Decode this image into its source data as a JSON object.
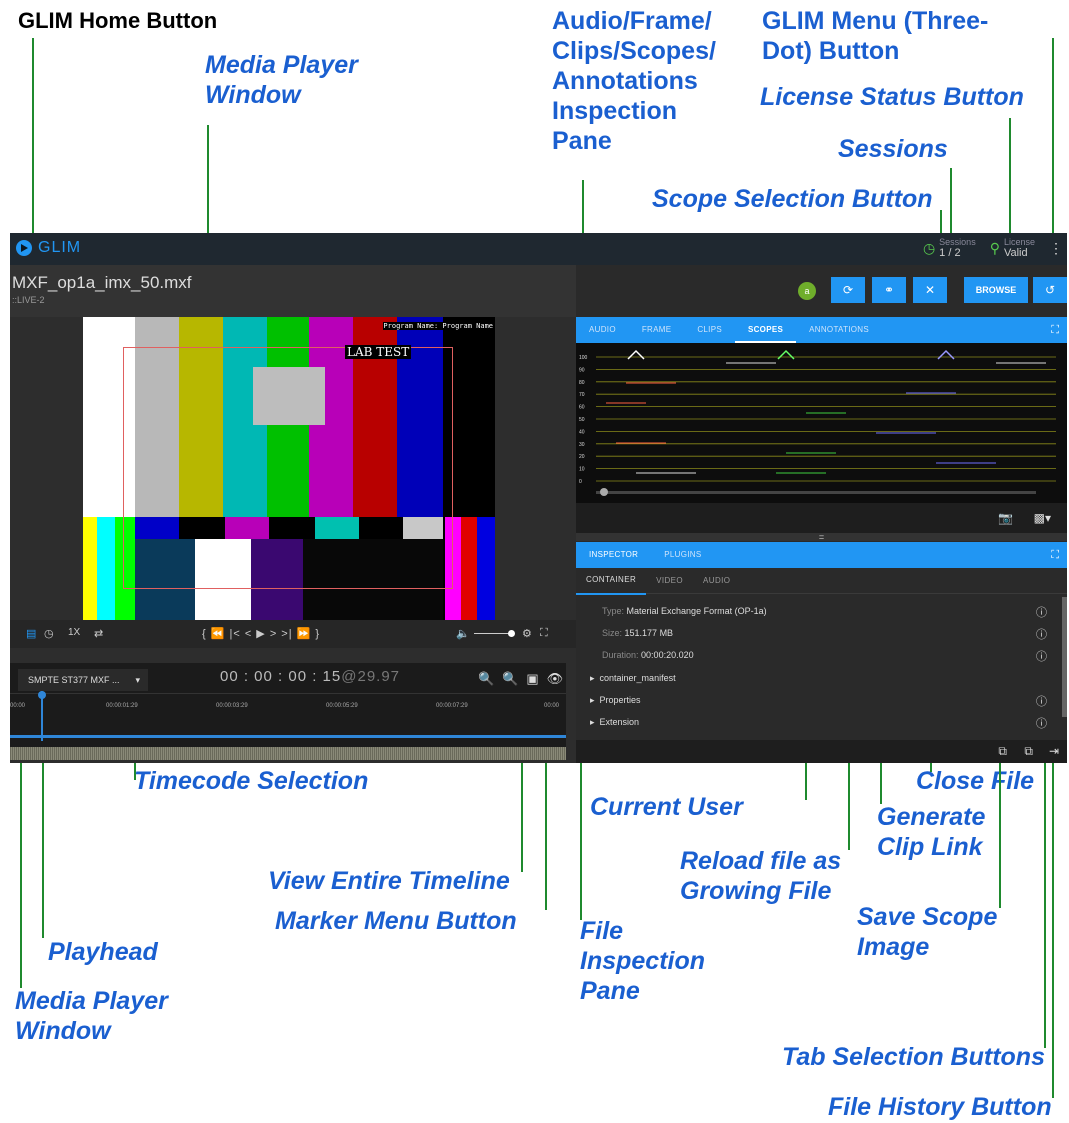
{
  "annotations": {
    "home_button": "GLIM Home Button",
    "media_player_top": "Media Player Window",
    "inspection_pane": "Audio/Frame/ Clips/Scopes/ Annotations Inspection Pane",
    "menu_button": "GLIM Menu (Three-Dot) Button",
    "license_status": "License Status Button",
    "sessions": "Sessions",
    "scope_selection": "Scope Selection Button",
    "timecode_selection": "Timecode Selection",
    "current_user": "Current User",
    "close_file": "Close File",
    "generate_clip_link": "Generate Clip Link",
    "reload_growing": "Reload file as Growing File",
    "view_timeline": "View Entire Timeline",
    "marker_menu": "Marker Menu Button",
    "save_scope": "Save Scope Image",
    "playhead": "Playhead",
    "file_inspection": "File Inspection Pane",
    "media_player_bottom": "Media Player Window",
    "tab_selection": "Tab Selection Buttons",
    "file_history": "File History Button"
  },
  "app": {
    "logo": "GLIM",
    "sessions_label": "Sessions",
    "sessions_value": "1 / 2",
    "license_label": "License",
    "license_value": "Valid",
    "file_name": "MXF_op1a_imx_50.mxf",
    "file_sub": "::LIVE-2",
    "video_overlay_text": "Program Name: Program Name",
    "video_label": "LAB TEST",
    "speed": "1X",
    "transport": "{   ⏪   |<   <   ▶   >   >|   ⏩   }",
    "timecode_format": "SMPTE ST377 MXF ...",
    "timecode": "00 : 00 : 00 : 15",
    "fps": "@29.97",
    "ruler_labels": [
      "00:00",
      "00:00:01:29",
      "00:00:03:29",
      "00:00:05:29",
      "00:00:07:29",
      "00:00"
    ],
    "user_initial": "a",
    "browse_label": "BROWSE",
    "top_tabs": [
      "AUDIO",
      "FRAME",
      "CLIPS",
      "SCOPES",
      "ANNOTATIONS"
    ],
    "active_top_tab": "SCOPES",
    "scope_ticks": [
      "100",
      "90",
      "80",
      "70",
      "60",
      "50",
      "40",
      "30",
      "20",
      "10",
      "0"
    ],
    "inspector_tabs": [
      "INSPECTOR",
      "PLUGINS"
    ],
    "sub_tabs": [
      "CONTAINER",
      "VIDEO",
      "AUDIO"
    ],
    "type_label": "Type:",
    "type_value": "Material Exchange Format (OP-1a)",
    "size_label": "Size:",
    "size_value": "151.177 MB",
    "duration_label": "Duration:",
    "duration_value": "00:00:20.020",
    "tree_items": [
      "container_manifest",
      "Properties",
      "Extension"
    ]
  },
  "colors": {
    "accent": "#2196f3",
    "annotation": "#1a5fd0",
    "leader": "#1f8a2e",
    "user_avatar": "#6fae2b"
  }
}
